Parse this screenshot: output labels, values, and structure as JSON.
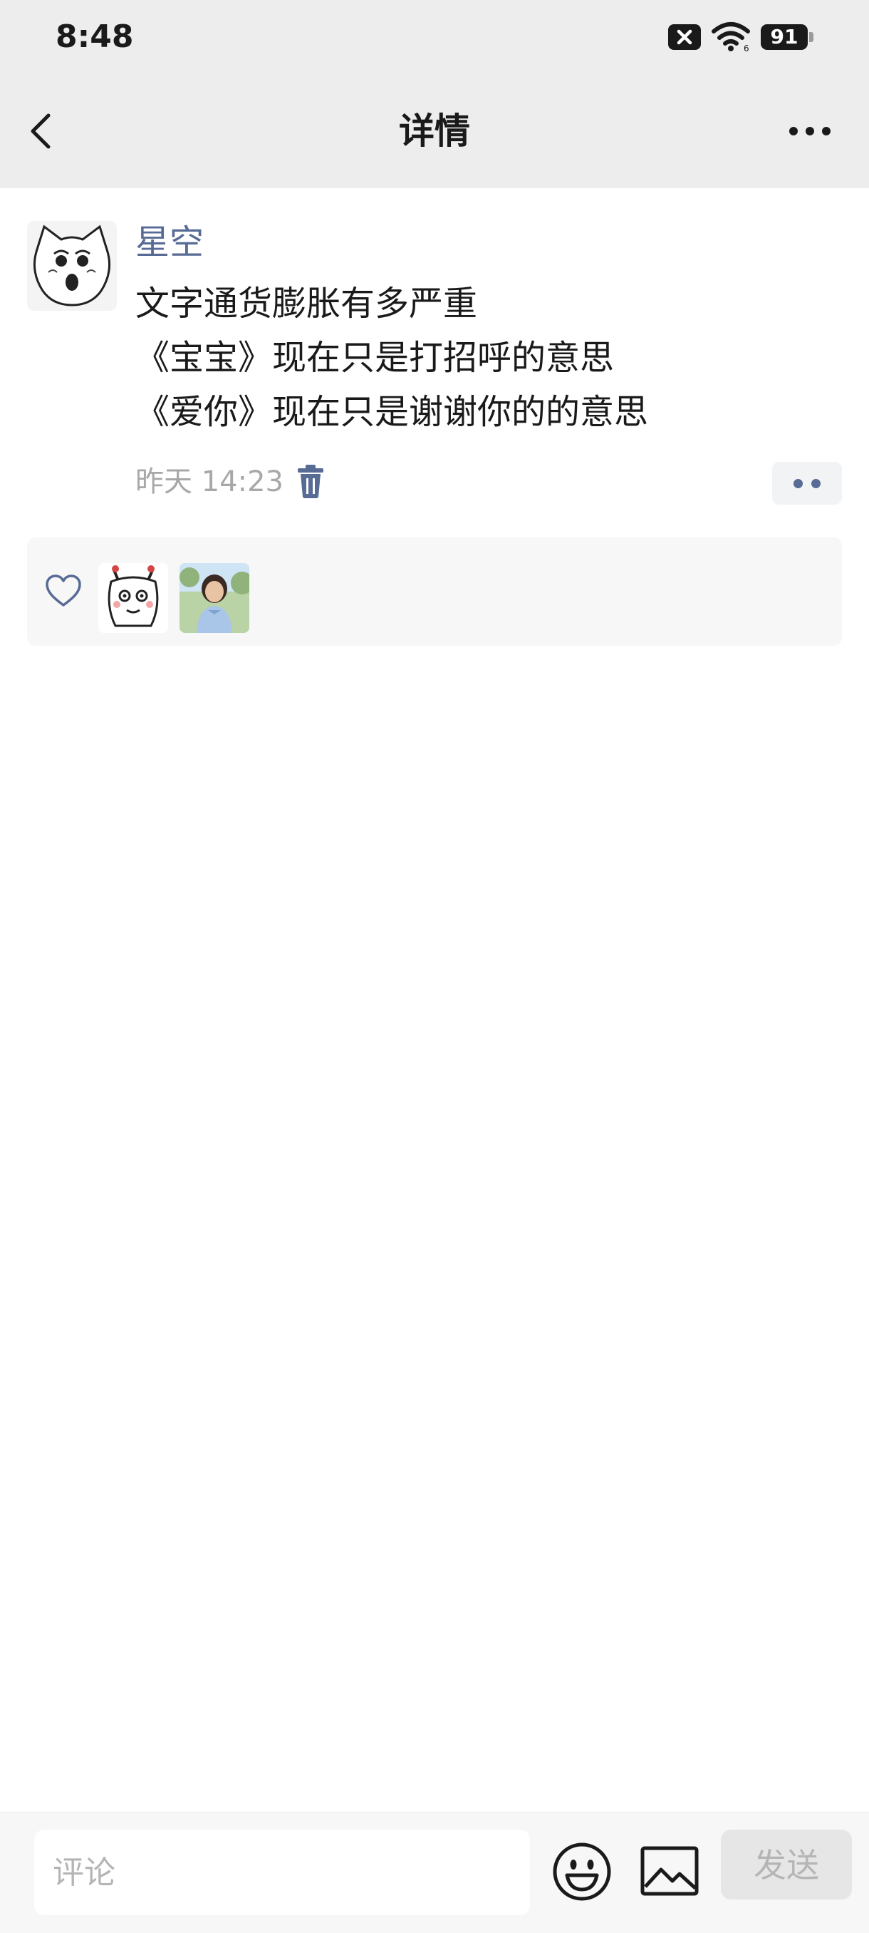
{
  "status_bar": {
    "time": "8:48",
    "battery": "91",
    "icons": [
      "sim-blocked-icon",
      "wifi-icon",
      "battery-icon"
    ]
  },
  "nav": {
    "title": "详情",
    "back_icon": "chevron-left-icon",
    "more_icon": "more-dots-icon"
  },
  "post": {
    "author": "星空",
    "lines": [
      "文字通货膨胀有多严重",
      "《宝宝》现在只是打招呼的意思",
      "《爱你》现在只是谢谢你的的意思"
    ],
    "time": "昨天 14:23",
    "delete_icon": "trash-icon",
    "action_icon": "two-dots-icon"
  },
  "likes": {
    "icon": "heart-icon",
    "count_visible": 2
  },
  "comment_bar": {
    "placeholder": "评论",
    "emoji_icon": "smiley-icon",
    "image_icon": "image-icon",
    "send_label": "发送"
  },
  "colors": {
    "header_bg": "#ededed",
    "link_blue": "#576b95",
    "muted_text": "#a8a8a8",
    "panel_bg": "#f7f7f7"
  }
}
